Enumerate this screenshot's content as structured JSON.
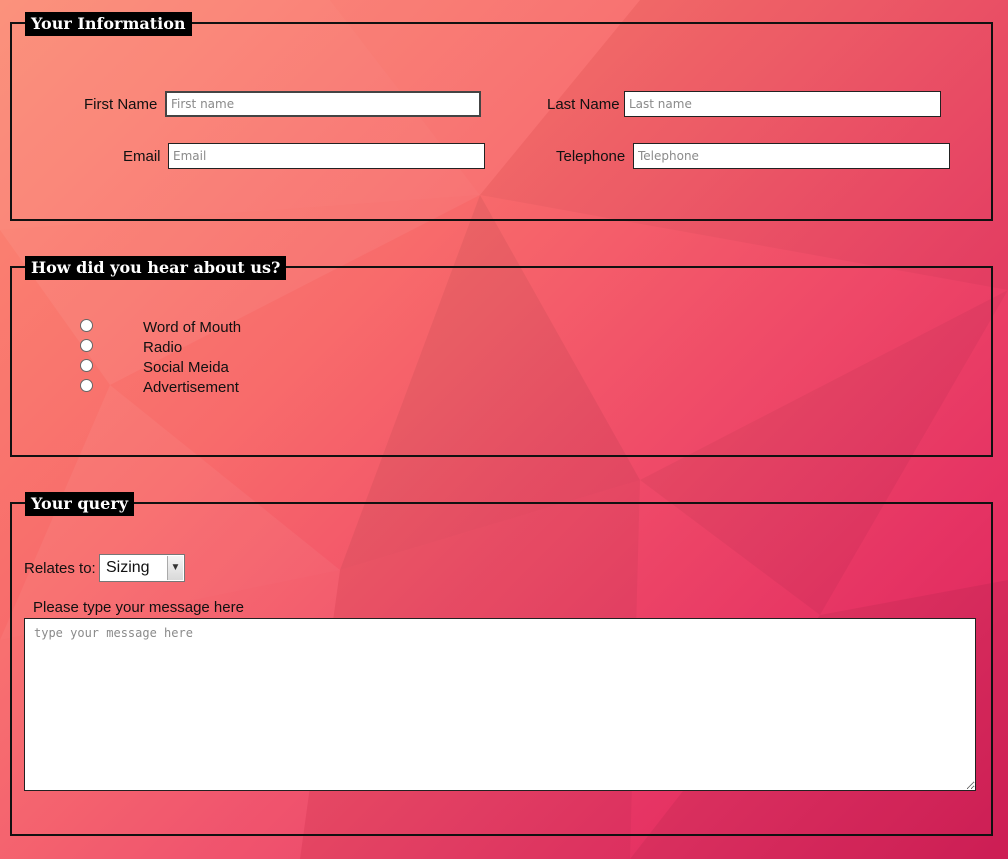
{
  "sections": {
    "info": {
      "legend": "Your Information",
      "first_name": {
        "label": "First Name",
        "placeholder": "First name",
        "value": ""
      },
      "last_name": {
        "label": "Last Name",
        "placeholder": "Last name",
        "value": ""
      },
      "email": {
        "label": "Email",
        "placeholder": "Email",
        "value": ""
      },
      "telephone": {
        "label": "Telephone",
        "placeholder": "Telephone",
        "value": ""
      }
    },
    "hear": {
      "legend": "How did you hear about us?",
      "options": [
        {
          "label": "Word of Mouth",
          "checked": false
        },
        {
          "label": "Radio",
          "checked": false
        },
        {
          "label": "Social Meida",
          "checked": false
        },
        {
          "label": "Advertisement",
          "checked": false
        }
      ]
    },
    "query": {
      "legend": "Your query",
      "relates_label": "Relates to:",
      "relates_value": "Sizing",
      "message_label": "Please type your message here",
      "message_placeholder": "type your message here",
      "message_value": ""
    }
  },
  "colors": {
    "bg_light": "#fb8a73",
    "bg_dark": "#d81f59",
    "legend_bg": "#000000",
    "legend_text": "#ffffff"
  },
  "icons": {
    "select_arrow": "chevron-down-icon",
    "resize_grip": "resize-grip-icon"
  }
}
